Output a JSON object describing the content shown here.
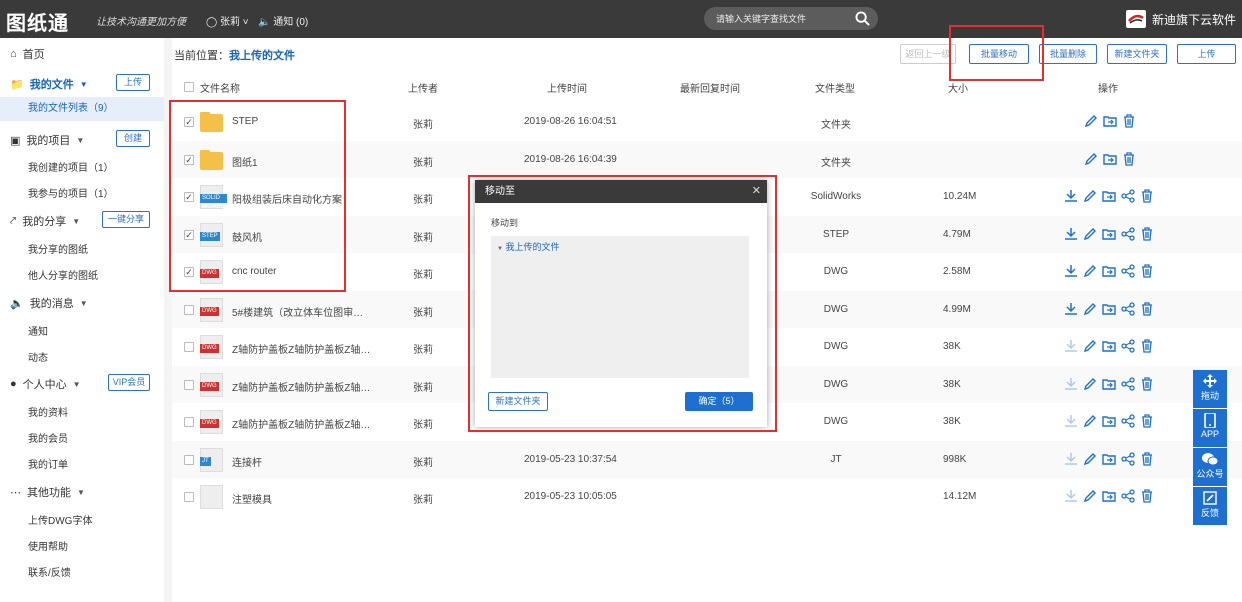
{
  "app": {
    "logo": "图纸通",
    "slogan": "让技术沟通更加方便"
  },
  "header": {
    "user": "张莉",
    "notice": "通知 (0)",
    "search_placeholder": "请输入关键字查找文件",
    "brand": "新迪旗下云软件"
  },
  "sidebar": {
    "home": "首页",
    "my_files": {
      "label": "我的文件",
      "button": "上传",
      "items": [
        "我的文件列表（9）"
      ]
    },
    "my_projects": {
      "label": "我的项目",
      "button": "创建",
      "items": [
        "我创建的项目（1）",
        "我参与的项目（1）"
      ]
    },
    "my_share": {
      "label": "我的分享",
      "button": "一键分享",
      "items": [
        "我分享的图纸",
        "他人分享的图纸"
      ]
    },
    "my_messages": {
      "label": "我的消息",
      "items": [
        "通知",
        "动态"
      ]
    },
    "personal": {
      "label": "个人中心",
      "button": "VIP会员",
      "items": [
        "我的资料",
        "我的会员",
        "我的订单"
      ]
    },
    "other": {
      "label": "其他功能",
      "items": [
        "上传DWG字体",
        "使用帮助",
        "联系/反馈"
      ]
    }
  },
  "breadcrumb": {
    "prefix": "当前位置：",
    "current": "我上传的文件"
  },
  "toolbar": {
    "back": "返回上一级",
    "batch_move": "批量移动",
    "batch_delete": "批量删除",
    "new_folder": "新建文件夹",
    "upload": "上传"
  },
  "table": {
    "headers": [
      "文件名称",
      "上传者",
      "上传时间",
      "最新回复时间",
      "文件类型",
      "大小",
      "操作"
    ],
    "rows": [
      {
        "name": "STEP",
        "uploader": "张莉",
        "time": "2019-08-26 16:04:51",
        "type": "文件夹",
        "size": "",
        "checked": true,
        "icon": "folder"
      },
      {
        "name": "图纸1",
        "uploader": "张莉",
        "time": "2019-08-26 16:04:39",
        "type": "文件夹",
        "size": "",
        "checked": true,
        "icon": "folder"
      },
      {
        "name": "阳极组装后床自动化方案",
        "uploader": "张莉",
        "time": "",
        "type": "SolidWorks",
        "size": "10.24M",
        "checked": true,
        "icon": "solidworks"
      },
      {
        "name": "鼓风机",
        "uploader": "张莉",
        "time": "",
        "type": "STEP",
        "size": "4.79M",
        "checked": true,
        "icon": "step"
      },
      {
        "name": "cnc router",
        "uploader": "张莉",
        "time": "",
        "type": "DWG",
        "size": "2.58M",
        "checked": true,
        "icon": "dwg"
      },
      {
        "name": "5#楼建筑（改立体车位图审…",
        "uploader": "张莉",
        "time": "",
        "type": "DWG",
        "size": "4.99M",
        "checked": false,
        "icon": "dwg"
      },
      {
        "name": "Z轴防护盖板Z轴防护盖板Z轴…",
        "uploader": "张莉",
        "time": "",
        "type": "DWG",
        "size": "38K",
        "checked": false,
        "icon": "dwg"
      },
      {
        "name": "Z轴防护盖板Z轴防护盖板Z轴…",
        "uploader": "张莉",
        "time": "",
        "type": "DWG",
        "size": "38K",
        "checked": false,
        "icon": "dwg"
      },
      {
        "name": "Z轴防护盖板Z轴防护盖板Z轴…",
        "uploader": "张莉",
        "time": "",
        "type": "DWG",
        "size": "38K",
        "checked": false,
        "icon": "dwg"
      },
      {
        "name": "连接杆",
        "uploader": "张莉",
        "time": "2019-05-23 10:37:54",
        "type": "JT",
        "size": "998K",
        "checked": false,
        "icon": "jt"
      },
      {
        "name": "注塑模具",
        "uploader": "张莉",
        "time": "2019-05-23 10:05:05",
        "type": "",
        "size": "14.12M",
        "checked": false,
        "icon": "generic"
      }
    ]
  },
  "dialog": {
    "title": "移动至",
    "label": "移动到",
    "node": "我上传的文件",
    "new_folder": "新建文件夹",
    "confirm": "确定（5）"
  },
  "float_bar": [
    "拖动",
    "APP",
    "公众号",
    "反馈"
  ],
  "colors": {
    "accent": "#1e6fd0",
    "header": "#3a3a3a",
    "highlight": "#e03030"
  }
}
